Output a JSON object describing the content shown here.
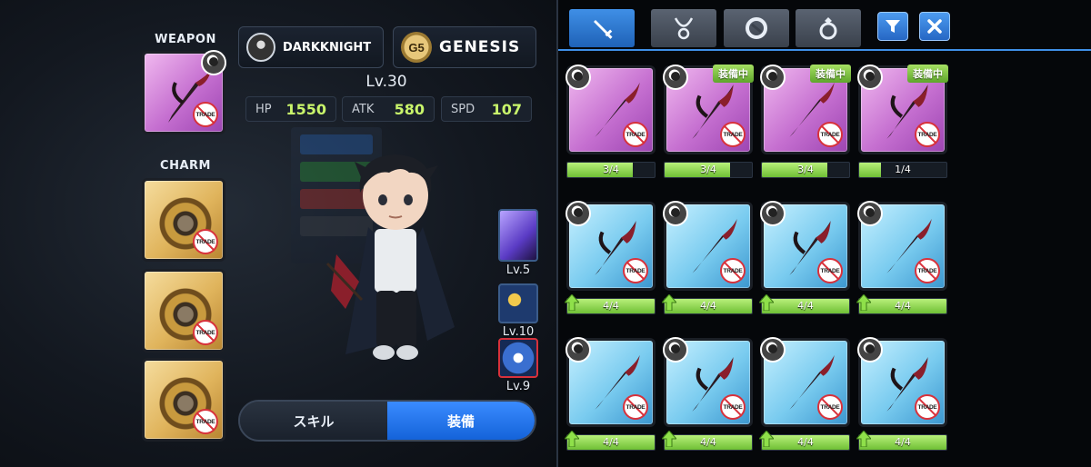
{
  "equip_slots": {
    "weapon_label": "WEAPON",
    "charm_label": "CHARM",
    "trade_label": "TRADE"
  },
  "player": {
    "name": "DARKKNIGHT",
    "guild_badge": "G5",
    "guild_name": "GENESIS",
    "level": "Lv.30"
  },
  "stats": [
    {
      "key": "HP",
      "value": "1550"
    },
    {
      "key": "ATK",
      "value": "580"
    },
    {
      "key": "SPD",
      "value": "107"
    }
  ],
  "skills": [
    {
      "level": "Lv.5",
      "icon": "dark-slash-skill-icon"
    },
    {
      "level": "Lv.10",
      "icon": "summon-skill-icon"
    },
    {
      "level": "Lv.9",
      "icon": "debuff-skill-icon"
    }
  ],
  "bottom_toggle": {
    "skill_label": "スキル",
    "equip_label": "装備",
    "active": "equip"
  },
  "tabs": [
    {
      "name": "weapon",
      "icon": "sword-icon",
      "active": true
    },
    {
      "name": "necklace",
      "icon": "necklace-icon",
      "active": false
    },
    {
      "name": "charm",
      "icon": "charm-icon",
      "active": false
    },
    {
      "name": "ring",
      "icon": "ring-icon",
      "active": false
    }
  ],
  "toolbar": {
    "filter_icon": "filter-icon",
    "close_icon": "close-icon"
  },
  "inventory": {
    "equipped_label": "装備中",
    "rows": [
      [
        {
          "rarity": "purple",
          "progress": "3/4",
          "fill": 0.75,
          "equipped": false,
          "upgrade": false
        },
        {
          "rarity": "purple",
          "progress": "3/4",
          "fill": 0.75,
          "equipped": true,
          "upgrade": false
        },
        {
          "rarity": "purple",
          "progress": "3/4",
          "fill": 0.75,
          "equipped": true,
          "upgrade": false
        },
        {
          "rarity": "purple",
          "progress": "1/4",
          "fill": 0.25,
          "equipped": true,
          "upgrade": false
        }
      ],
      [
        {
          "rarity": "blue",
          "progress": "4/4",
          "fill": 1.0,
          "equipped": false,
          "upgrade": true
        },
        {
          "rarity": "blue",
          "progress": "4/4",
          "fill": 1.0,
          "equipped": false,
          "upgrade": true
        },
        {
          "rarity": "blue",
          "progress": "4/4",
          "fill": 1.0,
          "equipped": false,
          "upgrade": true
        },
        {
          "rarity": "blue",
          "progress": "4/4",
          "fill": 1.0,
          "equipped": false,
          "upgrade": true
        }
      ],
      [
        {
          "rarity": "blue",
          "progress": "4/4",
          "fill": 1.0,
          "equipped": false,
          "upgrade": true
        },
        {
          "rarity": "blue",
          "progress": "4/4",
          "fill": 1.0,
          "equipped": false,
          "upgrade": true
        },
        {
          "rarity": "blue",
          "progress": "4/4",
          "fill": 1.0,
          "equipped": false,
          "upgrade": true
        },
        {
          "rarity": "blue",
          "progress": "4/4",
          "fill": 1.0,
          "equipped": false,
          "upgrade": true
        }
      ]
    ]
  },
  "colors": {
    "accent_blue": "#1f62b7",
    "stat_value": "#c9f56b",
    "equipped_green": "#5ea52b",
    "purple_rarity": "#c56fd0",
    "blue_rarity": "#79cbef",
    "gold_rarity": "#e0b45c"
  }
}
